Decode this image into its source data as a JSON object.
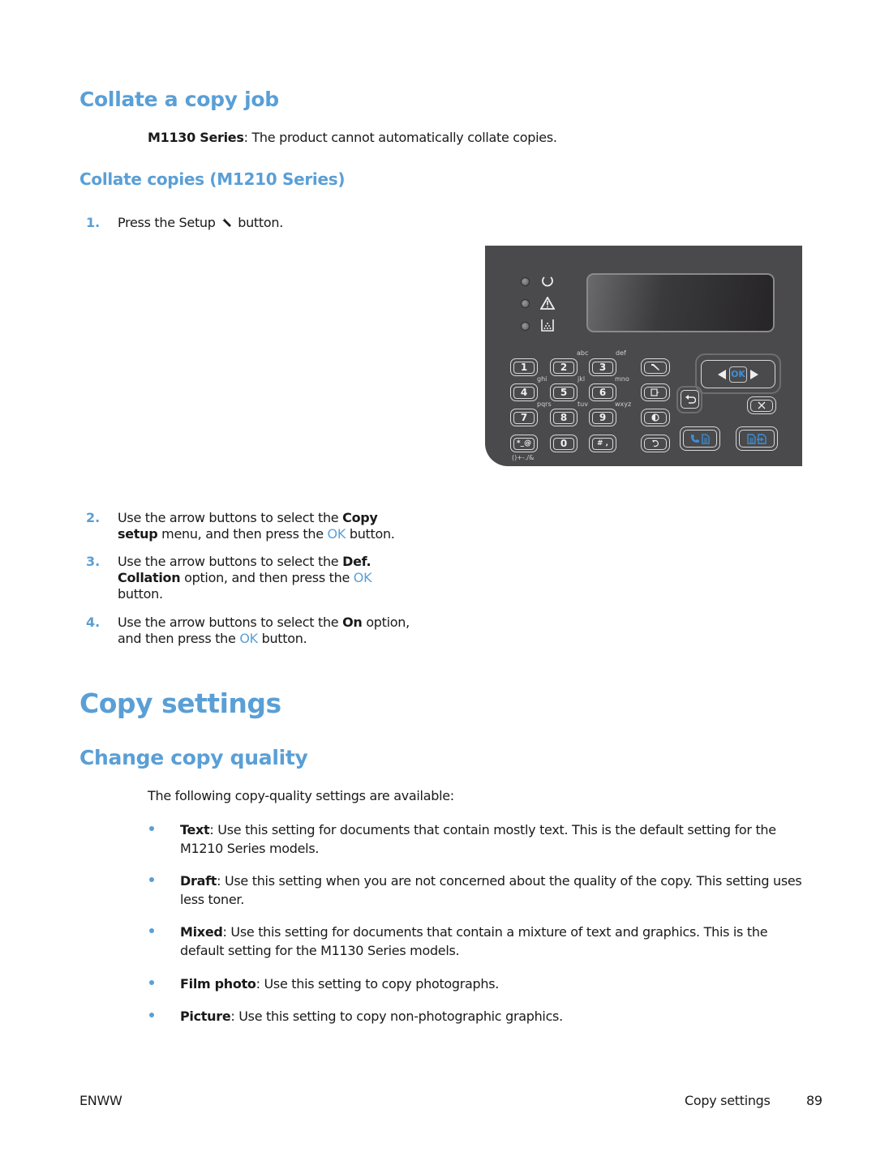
{
  "sections": {
    "collate_title": "Collate a copy job",
    "m1130_note": {
      "bold": "M1130 Series",
      "rest": ": The product cannot automatically collate copies."
    },
    "collate_m1210_title": "Collate copies (M1210 Series)",
    "steps": [
      {
        "num": "1.",
        "text_before": "Press the Setup",
        "icon": "wrench-icon",
        "text_after": "button."
      },
      {
        "num": "2.",
        "line1_pre": "Use the arrow buttons to select the ",
        "line1_bold": "Copy",
        "line2_bold": "setup",
        "line2_mid": " menu, and then press the ",
        "ok": "OK",
        "line2_end": " button."
      },
      {
        "num": "3.",
        "line1_pre": "Use the arrow buttons to select the ",
        "line1_bold": "Def.",
        "line2_bold": "Collation",
        "line2_mid": " option, and then press the ",
        "ok": "OK",
        "line3": "button."
      },
      {
        "num": "4.",
        "line1_pre": "Use the arrow buttons to select the ",
        "line1_bold": "On",
        "line1_end": " option,",
        "line2_pre": "and then press the ",
        "ok": "OK",
        "line2_end": " button."
      }
    ],
    "copy_settings_title": "Copy settings",
    "change_quality_title": "Change copy quality",
    "quality_intro": "The following copy-quality settings are available:",
    "quality_items": [
      {
        "bold": "Text",
        "line1": ": Use this setting for documents that contain mostly text. This is the default setting for the",
        "line2": "M1210 Series models."
      },
      {
        "bold": "Draft",
        "line1": ": Use this setting when you are not concerned about the quality of the copy. This setting uses",
        "line2": "less toner."
      },
      {
        "bold": "Mixed",
        "line1": ": Use this setting for documents that contain a mixture of text and graphics. This is the",
        "line2": "default setting for the M1130 Series models."
      },
      {
        "bold": "Film photo",
        "line1": ": Use this setting to copy photographs."
      },
      {
        "bold": "Picture",
        "line1": ": Use this setting to copy non-photographic graphics."
      }
    ]
  },
  "control_panel": {
    "status_icons": [
      "ready-icon",
      "attention-icon",
      "toner-icon"
    ],
    "keypad": [
      {
        "key": "1",
        "letters": ""
      },
      {
        "key": "2",
        "letters": "abc"
      },
      {
        "key": "3",
        "letters": "def"
      },
      {
        "key": "4",
        "letters": "ghi"
      },
      {
        "key": "5",
        "letters": "jkl"
      },
      {
        "key": "6",
        "letters": "mno"
      },
      {
        "key": "7",
        "letters": "pqrs"
      },
      {
        "key": "8",
        "letters": "tuv"
      },
      {
        "key": "9",
        "letters": "wxyz"
      },
      {
        "key": "*_@",
        "letters": ""
      },
      {
        "key": "0",
        "letters": ""
      },
      {
        "key": "# ,",
        "letters": ""
      }
    ],
    "symbols_label": "()+-./&",
    "ok_label": "OK",
    "accent_color": "#3d8fd6"
  },
  "footer": {
    "left": "ENWW",
    "section": "Copy settings",
    "page": "89"
  }
}
